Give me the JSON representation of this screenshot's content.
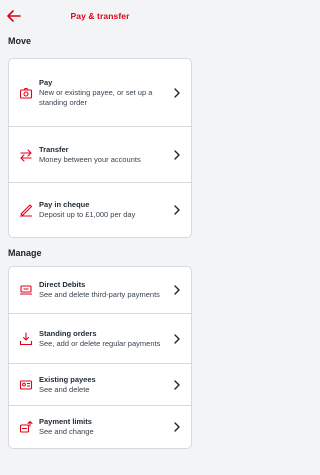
{
  "header": {
    "title": "Pay & transfer"
  },
  "move": {
    "title": "Move",
    "items": [
      {
        "title": "Pay",
        "desc": "New or existing payee, or set up a standing order",
        "icon": "camera-pay-icon"
      },
      {
        "title": "Transfer",
        "desc": "Money between your accounts",
        "icon": "transfer-arrows-icon"
      },
      {
        "title": "Pay in cheque",
        "desc": "Deposit up to £1,000 per day",
        "icon": "cheque-pen-icon"
      }
    ]
  },
  "manage": {
    "title": "Manage",
    "items": [
      {
        "title": "Direct Debits",
        "desc": "See and delete third-party payments",
        "icon": "direct-debit-icon"
      },
      {
        "title": "Standing orders",
        "desc": "See, add or delete regular payments",
        "icon": "standing-order-icon"
      },
      {
        "title": "Existing payees",
        "desc": "See and delete",
        "icon": "payees-icon"
      },
      {
        "title": "Payment limits",
        "desc": "See and change",
        "icon": "payment-limits-icon"
      }
    ]
  },
  "colors": {
    "accent": "#e2001a",
    "background": "#f3f4f6",
    "card": "#ffffff"
  }
}
